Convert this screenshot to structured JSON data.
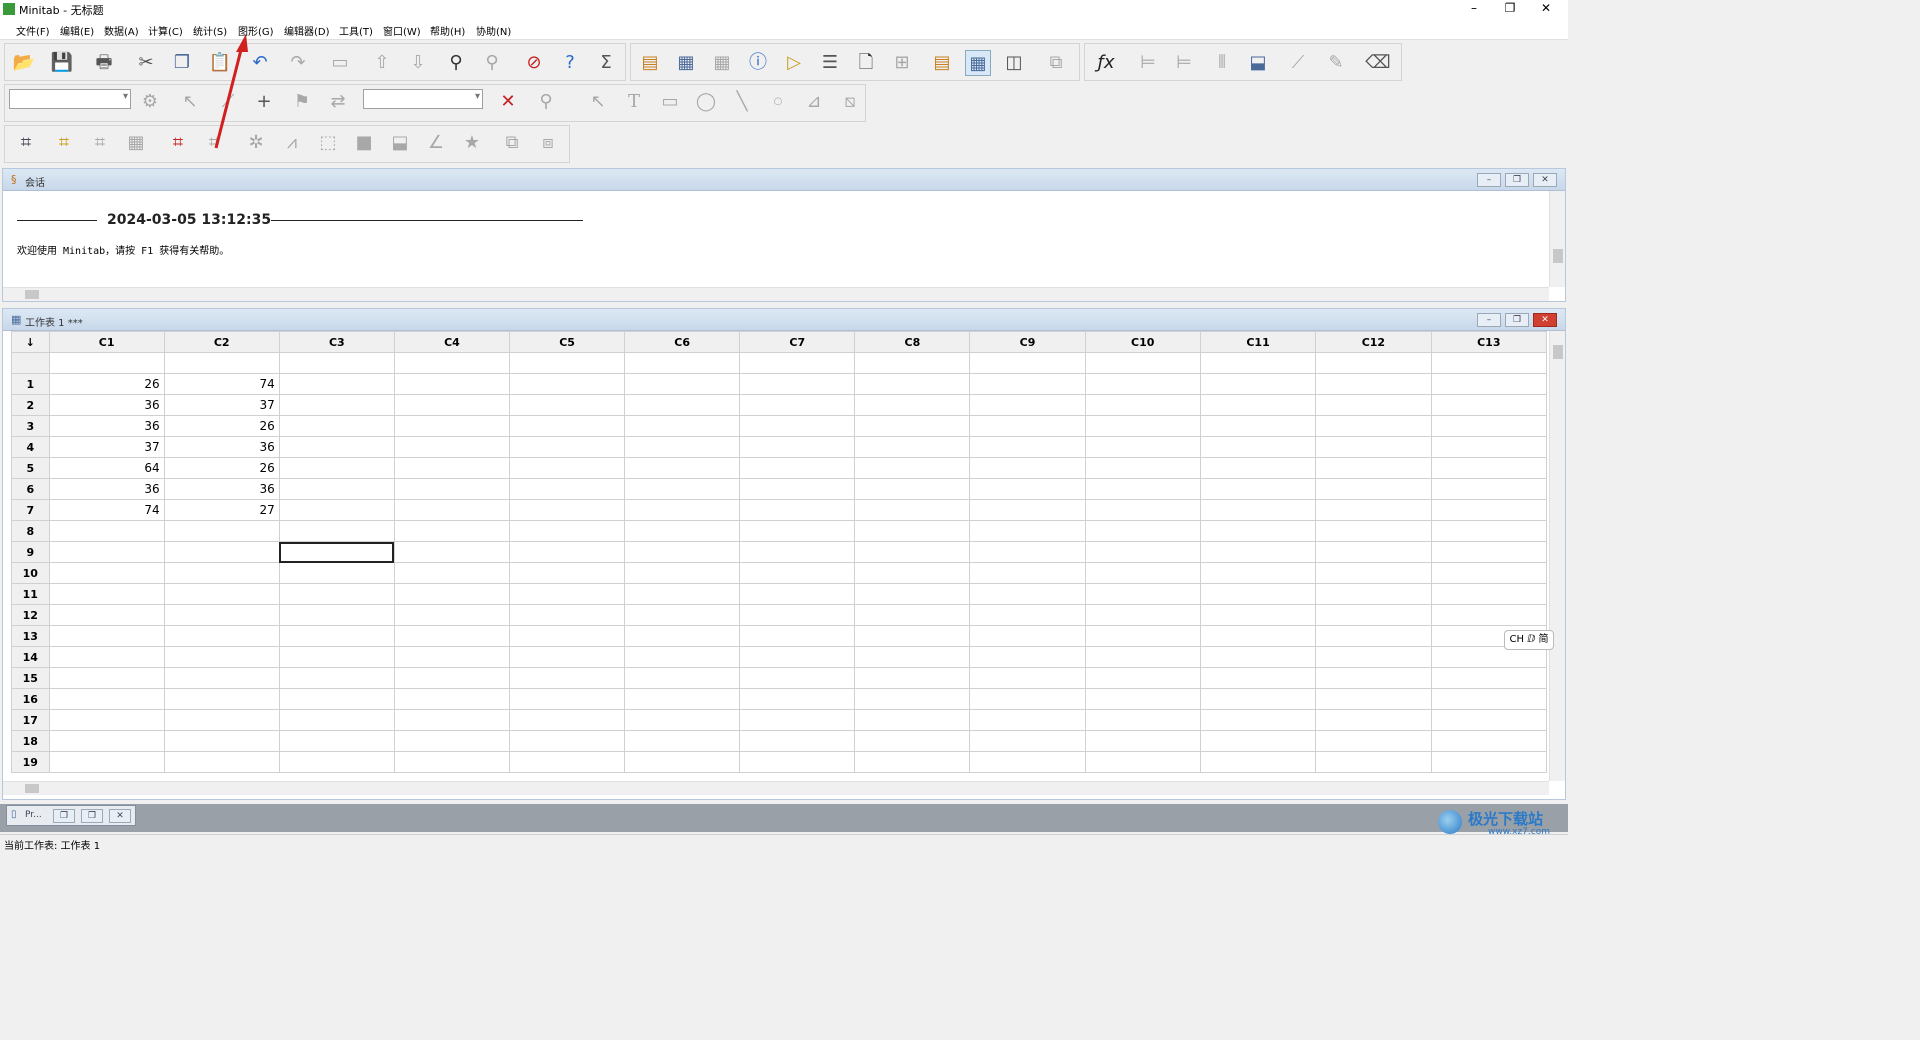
{
  "app": {
    "title": "Minitab - 无标题"
  },
  "window_controls": {
    "minimize": "–",
    "restore": "❐",
    "close": "✕"
  },
  "menu": [
    "文件(F)",
    "编辑(E)",
    "数据(A)",
    "计算(C)",
    "统计(S)",
    "图形(G)",
    "编辑器(D)",
    "工具(T)",
    "窗口(W)",
    "帮助(H)",
    "协助(N)"
  ],
  "session": {
    "title": "会话",
    "timestamp": "2024-03-05 13:12:35",
    "message": "欢迎使用 Minitab，请按 F1 获得有关帮助。"
  },
  "worksheet": {
    "title": "工作表 1 ***",
    "corner": "↓",
    "columns": [
      "C1",
      "C2",
      "C3",
      "C4",
      "C5",
      "C6",
      "C7",
      "C8",
      "C9",
      "C10",
      "C11",
      "C12",
      "C13"
    ],
    "rows": [
      {
        "n": "1",
        "c1": "26",
        "c2": "74"
      },
      {
        "n": "2",
        "c1": "36",
        "c2": "37"
      },
      {
        "n": "3",
        "c1": "36",
        "c2": "26"
      },
      {
        "n": "4",
        "c1": "37",
        "c2": "36"
      },
      {
        "n": "5",
        "c1": "64",
        "c2": "26"
      },
      {
        "n": "6",
        "c1": "36",
        "c2": "36"
      },
      {
        "n": "7",
        "c1": "74",
        "c2": "27"
      },
      {
        "n": "8",
        "c1": "",
        "c2": ""
      },
      {
        "n": "9",
        "c1": "",
        "c2": ""
      },
      {
        "n": "10",
        "c1": "",
        "c2": ""
      },
      {
        "n": "11",
        "c1": "",
        "c2": ""
      },
      {
        "n": "12",
        "c1": "",
        "c2": ""
      },
      {
        "n": "13",
        "c1": "",
        "c2": ""
      },
      {
        "n": "14",
        "c1": "",
        "c2": ""
      },
      {
        "n": "15",
        "c1": "",
        "c2": ""
      },
      {
        "n": "16",
        "c1": "",
        "c2": ""
      },
      {
        "n": "17",
        "c1": "",
        "c2": ""
      },
      {
        "n": "18",
        "c1": "",
        "c2": ""
      },
      {
        "n": "19",
        "c1": "",
        "c2": ""
      }
    ]
  },
  "minimized_window": {
    "label": "Pr..."
  },
  "status": {
    "text": "当前工作表: 工作表 1"
  },
  "ime": {
    "text": "CH ⅅ 简"
  },
  "watermark": {
    "main": "极光下载站",
    "url": "www.xz7.com"
  },
  "colors": {
    "accent_arrow": "#d02020",
    "title_gradient": "#c8d8ea"
  }
}
